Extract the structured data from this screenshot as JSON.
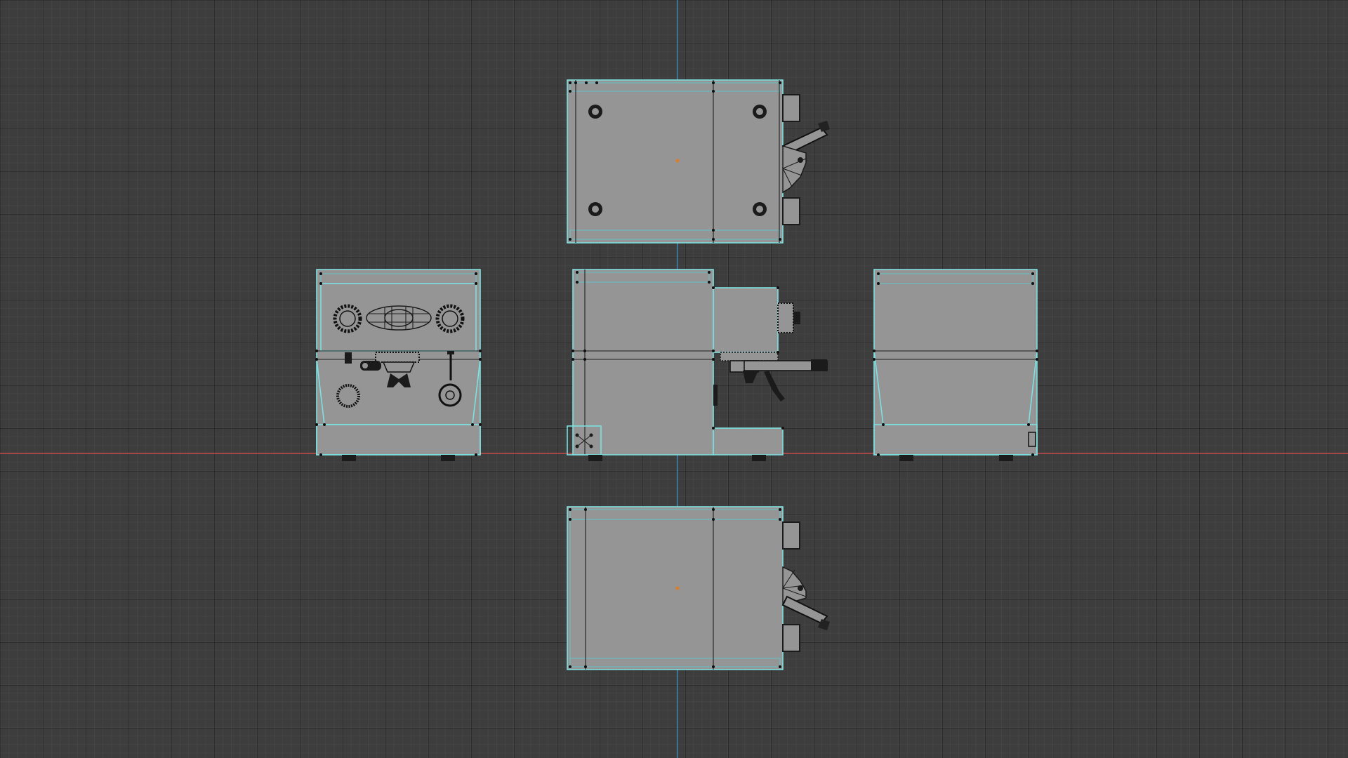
{
  "viewport": {
    "background": "#3d3d3d",
    "grid_color": "#2c2c2c",
    "x_axis_color": "#c44b4b",
    "y_axis_color": "#3f86b8",
    "wireframe_color": "#7ee0e0",
    "mesh_fill_color": "#959595",
    "origin_color": "#e07b2a"
  },
  "views": [
    {
      "id": "view-top"
    },
    {
      "id": "view-front"
    },
    {
      "id": "view-side-left"
    },
    {
      "id": "view-back"
    },
    {
      "id": "view-bottom"
    }
  ]
}
